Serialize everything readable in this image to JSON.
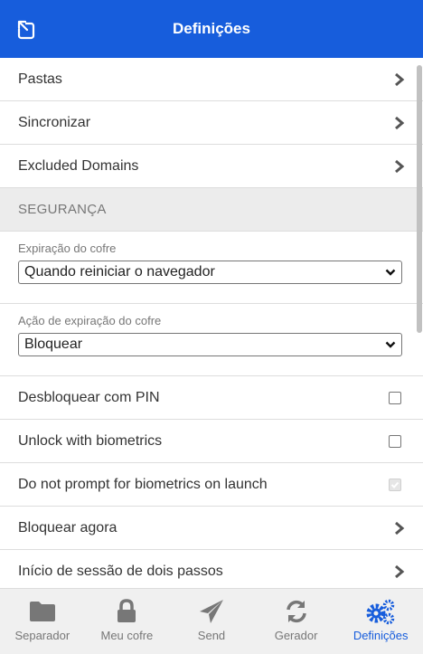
{
  "header": {
    "title": "Definições"
  },
  "rows_top": [
    {
      "label": "Pastas"
    },
    {
      "label": "Sincronizar"
    },
    {
      "label": "Excluded Domains"
    }
  ],
  "security": {
    "section_title": "SEGURANÇA",
    "vault_timeout": {
      "label": "Expiração do cofre",
      "value": "Quando reiniciar o navegador"
    },
    "vault_timeout_action": {
      "label": "Ação de expiração do cofre",
      "value": "Bloquear"
    },
    "unlock_pin": {
      "label": "Desbloquear com PIN",
      "checked": false
    },
    "unlock_biometrics": {
      "label": "Unlock with biometrics",
      "checked": false
    },
    "no_prompt_biometrics": {
      "label": "Do not prompt for biometrics on launch",
      "checked": true,
      "disabled": true
    },
    "lock_now": {
      "label": "Bloquear agora"
    },
    "two_step": {
      "label": "Início de sessão de dois passos"
    }
  },
  "tabs": [
    {
      "label": "Separador",
      "icon": "folder-icon",
      "active": false
    },
    {
      "label": "Meu cofre",
      "icon": "lock-icon",
      "active": false
    },
    {
      "label": "Send",
      "icon": "paper-plane-icon",
      "active": false
    },
    {
      "label": "Gerador",
      "icon": "refresh-icon",
      "active": false
    },
    {
      "label": "Definições",
      "icon": "cogs-icon",
      "active": true
    }
  ],
  "colors": {
    "brand": "#175ddc",
    "tab_inactive": "#777777"
  }
}
